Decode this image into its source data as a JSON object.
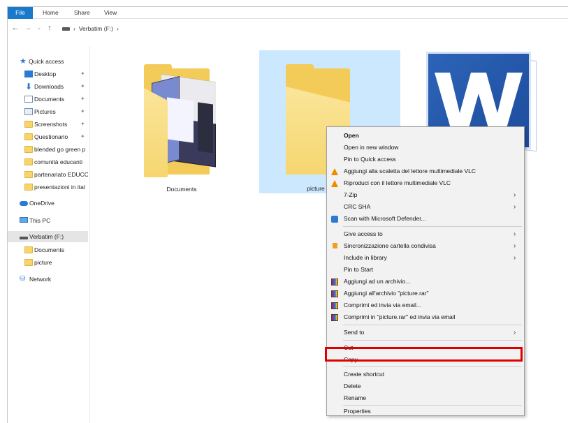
{
  "ribbon": {
    "tabs": [
      "File",
      "Home",
      "Share",
      "View"
    ]
  },
  "address": {
    "path": [
      "Verbatim (F:)"
    ],
    "separator": "›"
  },
  "nav": {
    "quick_access": "Quick access",
    "pinned": [
      "Desktop",
      "Downloads",
      "Documents",
      "Pictures",
      "Screenshots",
      "Questionario"
    ],
    "recent": [
      "blended go green p",
      "comunità educanti",
      "partenariato EDUCC",
      "presentazioni in ital"
    ],
    "onedrive": "OneDrive",
    "this_pc": "This PC",
    "drive": "Verbatim (F:)",
    "drive_children": [
      "Documents",
      "picture"
    ],
    "network": "Network"
  },
  "content": {
    "items": [
      {
        "label": "Documents",
        "selected": false
      },
      {
        "label": "picture",
        "selected": true
      }
    ]
  },
  "context_menu": {
    "items": [
      {
        "label": "Open",
        "bold": true
      },
      {
        "label": "Open in new window"
      },
      {
        "label": "Pin to Quick access"
      },
      {
        "label": "Aggiungi alla scaletta del lettore multimediale VLC",
        "icon": "vlc-icon"
      },
      {
        "label": "Riproduci con il lettore multimediale VLC",
        "icon": "vlc-icon"
      },
      {
        "label": "7-Zip",
        "submenu": true
      },
      {
        "label": "CRC SHA",
        "submenu": true
      },
      {
        "label": "Scan with Microsoft Defender...",
        "icon": "shield-icon"
      },
      {
        "separator": true
      },
      {
        "label": "Give access to",
        "submenu": true
      },
      {
        "label": "Sincronizzazione cartella condivisa",
        "icon": "sync-icon",
        "submenu": true
      },
      {
        "label": "Include in library",
        "submenu": true
      },
      {
        "label": "Pin to Start"
      },
      {
        "label": "Aggiungi ad un archivio...",
        "icon": "winrar-icon"
      },
      {
        "label": "Aggiungi all'archivio \"picture.rar\"",
        "icon": "winrar-icon"
      },
      {
        "label": "Comprimi ed invia via email...",
        "icon": "winrar-icon"
      },
      {
        "label": "Comprimi in \"picture.rar\" ed invia via email",
        "icon": "winrar-icon"
      },
      {
        "separator": true
      },
      {
        "label": "Send to",
        "submenu": true
      },
      {
        "separator": true
      },
      {
        "label": "Cut"
      },
      {
        "label": "Copy",
        "highlighted": true
      },
      {
        "separator": true
      },
      {
        "label": "Create shortcut"
      },
      {
        "label": "Delete"
      },
      {
        "label": "Rename"
      },
      {
        "separator": true
      },
      {
        "label": "Properties"
      }
    ],
    "submenu_glyph": "›"
  },
  "colors": {
    "accent": "#1979ca",
    "selection": "#cce8ff",
    "highlight_box": "#e00000"
  }
}
